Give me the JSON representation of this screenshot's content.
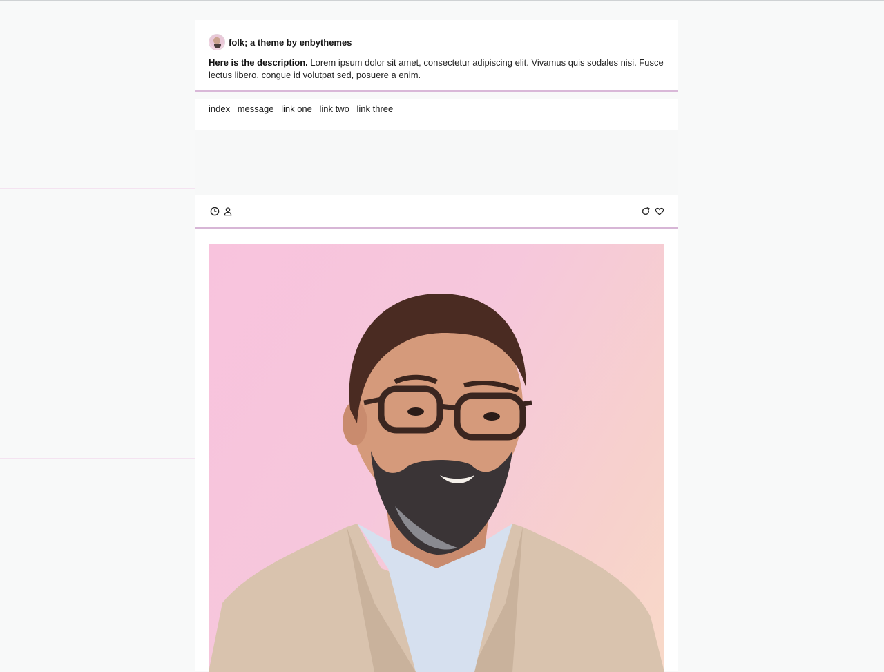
{
  "blog": {
    "title": "folk; a theme by enbythemes",
    "description_bold": "Here is the description.",
    "description_text": " Lorem ipsum dolor sit amet, consectetur adipiscing elit. Vivamus quis sodales nisi. Fusce lectus libero, congue id volutpat sed, posuere a enim."
  },
  "nav": {
    "items": [
      "index",
      "message",
      "link one",
      "link two",
      "link three"
    ]
  },
  "post": {
    "left_icons": [
      "clock-icon",
      "user-icon"
    ],
    "right_icons": [
      "reblog-icon",
      "heart-icon"
    ],
    "image_alt": "portrait photo"
  },
  "colors": {
    "accent": "#d9b8d8",
    "background": "#f8f9f9",
    "card": "#ffffff",
    "text": "#1a1a1a"
  }
}
